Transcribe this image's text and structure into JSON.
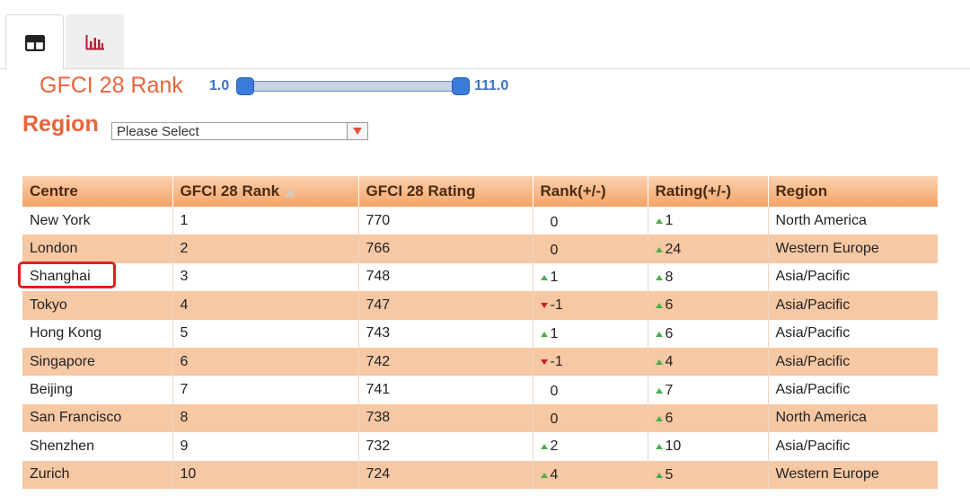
{
  "tabs": [
    {
      "icon": "table-icon",
      "active": true
    },
    {
      "icon": "bar-chart-icon",
      "active": false
    }
  ],
  "rank_filter": {
    "label": "GFCI 28 Rank",
    "min": "1.0",
    "max": "111.0"
  },
  "region_filter": {
    "label": "Region",
    "selected": "Please Select"
  },
  "colors": {
    "accent": "#e8643c",
    "slider": "#3b7bdb",
    "row_alt": "#f7c8a4",
    "up": "#4cae4c",
    "down": "#c62020",
    "highlight": "#e01f1f"
  },
  "table": {
    "headers": [
      "Centre",
      "GFCI 28 Rank",
      "GFCI 28 Rating",
      "Rank(+/-)",
      "Rating(+/-)",
      "Region"
    ],
    "rows": [
      {
        "centre": "New York",
        "rank": "1",
        "rating": "770",
        "rank_change": "0",
        "rank_dir": "none",
        "rating_change": "1",
        "rating_dir": "up",
        "region": "North America"
      },
      {
        "centre": "London",
        "rank": "2",
        "rating": "766",
        "rank_change": "0",
        "rank_dir": "none",
        "rating_change": "24",
        "rating_dir": "up",
        "region": "Western Europe"
      },
      {
        "centre": "Shanghai",
        "rank": "3",
        "rating": "748",
        "rank_change": "1",
        "rank_dir": "up",
        "rating_change": "8",
        "rating_dir": "up",
        "region": "Asia/Pacific"
      },
      {
        "centre": "Tokyo",
        "rank": "4",
        "rating": "747",
        "rank_change": "-1",
        "rank_dir": "down",
        "rating_change": "6",
        "rating_dir": "up",
        "region": "Asia/Pacific"
      },
      {
        "centre": "Hong Kong",
        "rank": "5",
        "rating": "743",
        "rank_change": "1",
        "rank_dir": "up",
        "rating_change": "6",
        "rating_dir": "up",
        "region": "Asia/Pacific"
      },
      {
        "centre": "Singapore",
        "rank": "6",
        "rating": "742",
        "rank_change": "-1",
        "rank_dir": "down",
        "rating_change": "4",
        "rating_dir": "up",
        "region": "Asia/Pacific"
      },
      {
        "centre": "Beijing",
        "rank": "7",
        "rating": "741",
        "rank_change": "0",
        "rank_dir": "none",
        "rating_change": "7",
        "rating_dir": "up",
        "region": "Asia/Pacific"
      },
      {
        "centre": "San Francisco",
        "rank": "8",
        "rating": "738",
        "rank_change": "0",
        "rank_dir": "none",
        "rating_change": "6",
        "rating_dir": "up",
        "region": "North America"
      },
      {
        "centre": "Shenzhen",
        "rank": "9",
        "rating": "732",
        "rank_change": "2",
        "rank_dir": "up",
        "rating_change": "10",
        "rating_dir": "up",
        "region": "Asia/Pacific"
      },
      {
        "centre": "Zurich",
        "rank": "10",
        "rating": "724",
        "rank_change": "4",
        "rank_dir": "up",
        "rating_change": "5",
        "rating_dir": "up",
        "region": "Western Europe"
      }
    ]
  }
}
